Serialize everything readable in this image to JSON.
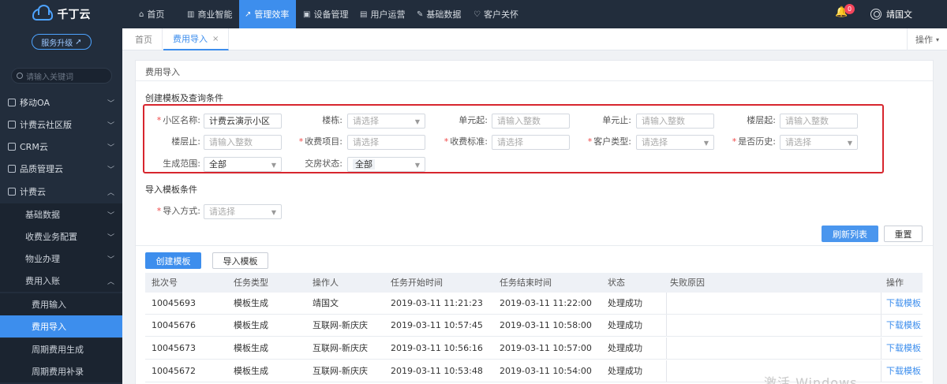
{
  "brand": {
    "logo_text": "千丁云",
    "upgrade_label": "服务升级"
  },
  "sidebar": {
    "search_placeholder": "请输入关键词",
    "items": [
      {
        "label": "移动OA"
      },
      {
        "label": "计费云社区版"
      },
      {
        "label": "CRM云"
      },
      {
        "label": "品质管理云"
      },
      {
        "label": "计费云"
      },
      {
        "label": "基础数据"
      },
      {
        "label": "收费业务配置"
      },
      {
        "label": "物业办理"
      },
      {
        "label": "费用入账"
      },
      {
        "label": "费用输入"
      },
      {
        "label": "费用导入"
      },
      {
        "label": "周期费用生成"
      },
      {
        "label": "周期费用补录"
      }
    ]
  },
  "topnav": {
    "items": [
      {
        "label": "首页"
      },
      {
        "label": "商业智能"
      },
      {
        "label": "管理效率"
      },
      {
        "label": "设备管理"
      },
      {
        "label": "用户运营"
      },
      {
        "label": "基础数据"
      },
      {
        "label": "客户关怀"
      }
    ],
    "notification_count": "0",
    "user_name": "靖国文"
  },
  "tabs": {
    "items": [
      {
        "label": "首页"
      },
      {
        "label": "费用导入"
      }
    ],
    "close_glyph": "×",
    "ops_label": "操作"
  },
  "page": {
    "title": "费用导入",
    "section_query": "创建模板及查询条件",
    "section_import": "导入模板条件"
  },
  "form": {
    "community_label": "小区名称:",
    "community_value": "计费云演示小区",
    "building_label": "楼栋:",
    "building_placeholder": "请选择",
    "unit_start_label": "单元起:",
    "unit_start_placeholder": "请输入整数",
    "unit_end_label": "单元止:",
    "unit_end_placeholder": "请输入整数",
    "floor_start_label": "楼层起:",
    "floor_start_placeholder": "请输入整数",
    "floor_end_label": "楼层止:",
    "floor_end_placeholder": "请输入整数",
    "fee_item_label": "收费项目:",
    "fee_item_placeholder": "请选择",
    "fee_standard_label": "收费标准:",
    "fee_standard_placeholder": "请选择",
    "customer_type_label": "客户类型:",
    "customer_type_placeholder": "请选择",
    "is_history_label": "是否历史:",
    "is_history_placeholder": "请选择",
    "gen_range_label": "生成范围:",
    "gen_range_value": "全部",
    "delivery_label": "交房状态:",
    "delivery_value": "全部",
    "import_method_label": "导入方式:",
    "import_method_placeholder": "请选择"
  },
  "buttons": {
    "refresh": "刷新列表",
    "reset": "重置",
    "create_template": "创建模板",
    "import_template": "导入模板"
  },
  "table": {
    "headers": [
      "批次号",
      "任务类型",
      "操作人",
      "任务开始时间",
      "任务结束时间",
      "状态",
      "失败原因",
      "操作"
    ],
    "rows": [
      [
        "10045693",
        "模板生成",
        "靖国文",
        "2019-03-11 11:21:23",
        "2019-03-11 11:22:00",
        "处理成功",
        "",
        "下载模板"
      ],
      [
        "10045676",
        "模板生成",
        "互联网-新庆庆",
        "2019-03-11 10:57:45",
        "2019-03-11 10:58:00",
        "处理成功",
        "",
        "下载模板"
      ],
      [
        "10045673",
        "模板生成",
        "互联网-新庆庆",
        "2019-03-11 10:56:16",
        "2019-03-11 10:57:00",
        "处理成功",
        "",
        "下载模板"
      ],
      [
        "10045672",
        "模板生成",
        "互联网-新庆庆",
        "2019-03-11 10:53:48",
        "2019-03-11 10:54:00",
        "处理成功",
        "",
        "下载模板"
      ]
    ]
  },
  "watermark": "激活 Windows",
  "colors": {
    "accent": "#3d8eed",
    "sidebar_bg": "#222d3c",
    "highlight_border": "#d7262e",
    "required": "#f04848"
  }
}
